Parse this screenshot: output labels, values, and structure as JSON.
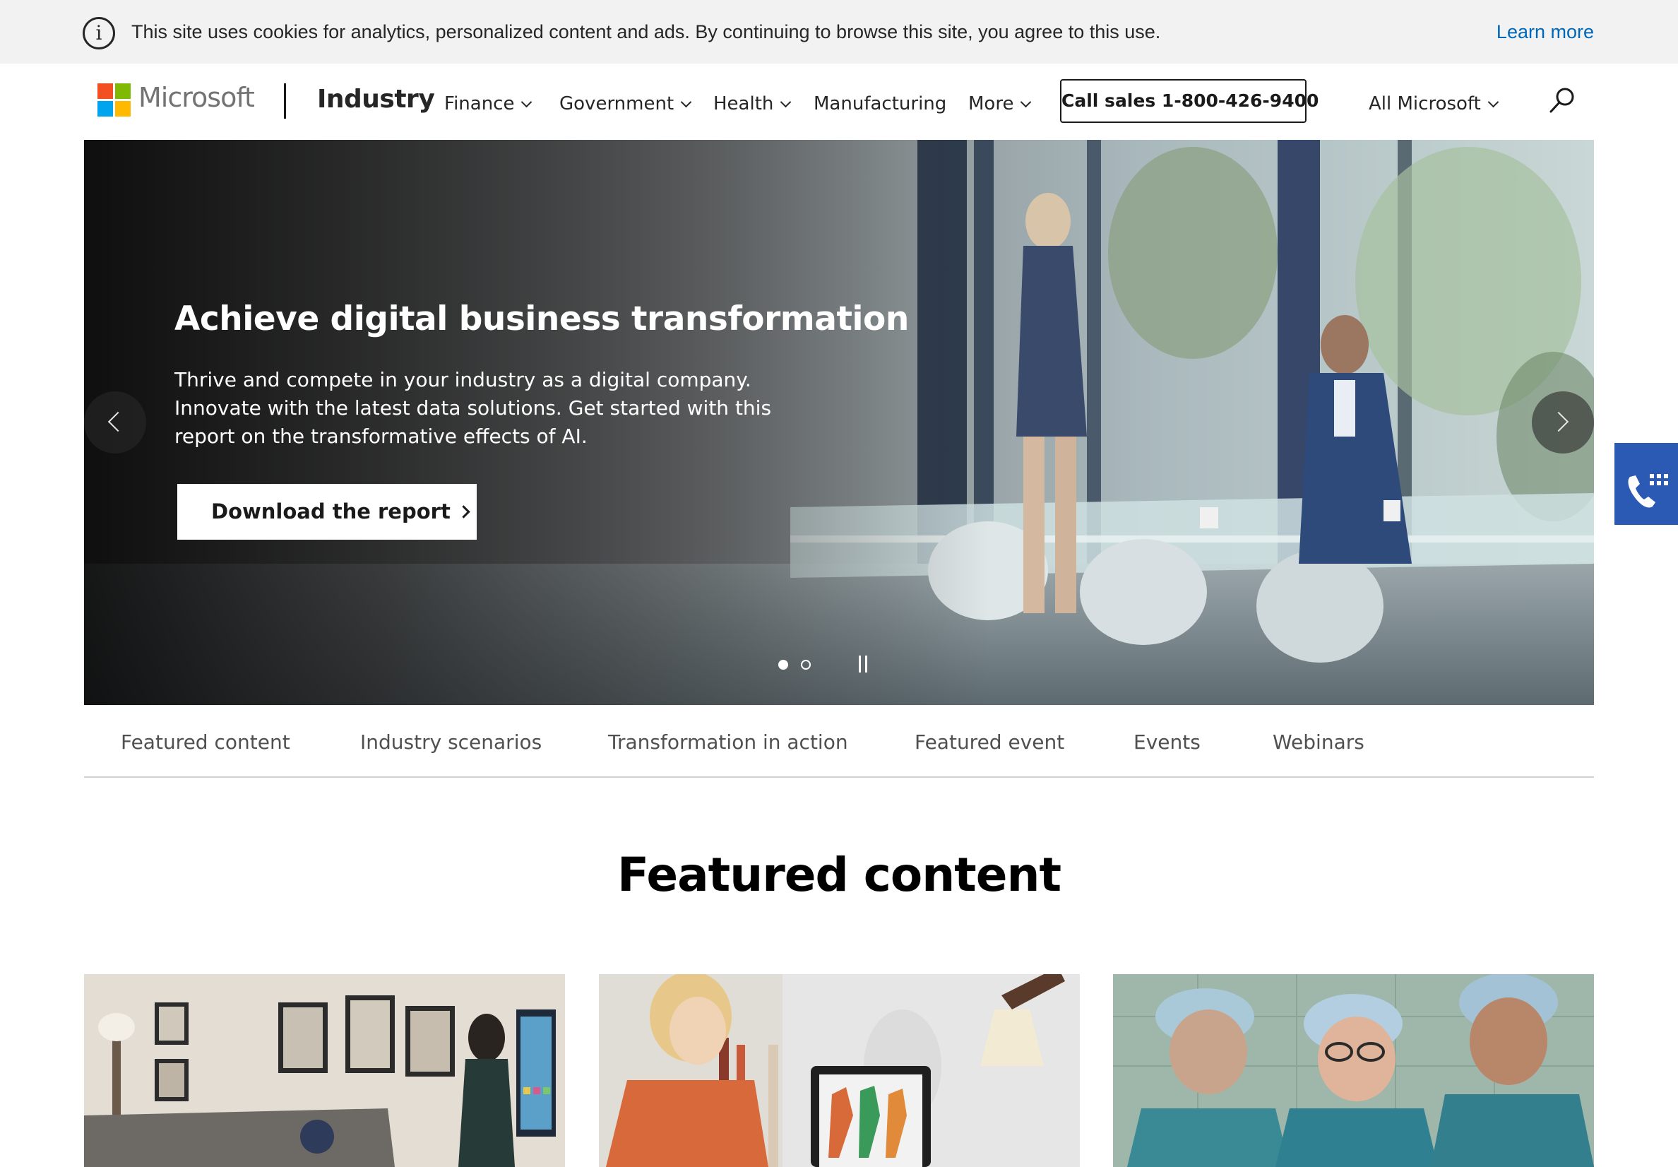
{
  "cookie_banner": {
    "text": "This site uses cookies for analytics, personalized content and ads. By continuing to browse this site, you agree to this use.",
    "learn_more": "Learn more",
    "icon": "info-icon"
  },
  "header": {
    "brand": "Microsoft",
    "site_title": "Industry",
    "nav": [
      {
        "label": "Finance",
        "has_menu": true
      },
      {
        "label": "Government",
        "has_menu": true
      },
      {
        "label": "Health",
        "has_menu": true
      },
      {
        "label": "Manufacturing",
        "has_menu": false
      },
      {
        "label": "More",
        "has_menu": true
      }
    ],
    "call_sales": "Call sales 1-800-426-9400",
    "all_microsoft": "All Microsoft",
    "search_icon": "search-icon"
  },
  "hero": {
    "title": "Achieve digital business transformation",
    "body": "Thrive and compete in your industry as a digital company. Innovate with the latest data solutions. Get started with this report on the transformative effects of AI.",
    "cta": "Download the report",
    "slide_count": 2,
    "active_slide": 1
  },
  "tabs": [
    "Featured content",
    "Industry scenarios",
    "Transformation in action",
    "Featured event",
    "Events",
    "Webinars"
  ],
  "featured": {
    "title": "Featured content"
  },
  "colors": {
    "accent_link": "#0067b8",
    "floating_call": "#2a5ab3",
    "logo": [
      "#f25022",
      "#7fba00",
      "#00a4ef",
      "#ffb900"
    ]
  }
}
